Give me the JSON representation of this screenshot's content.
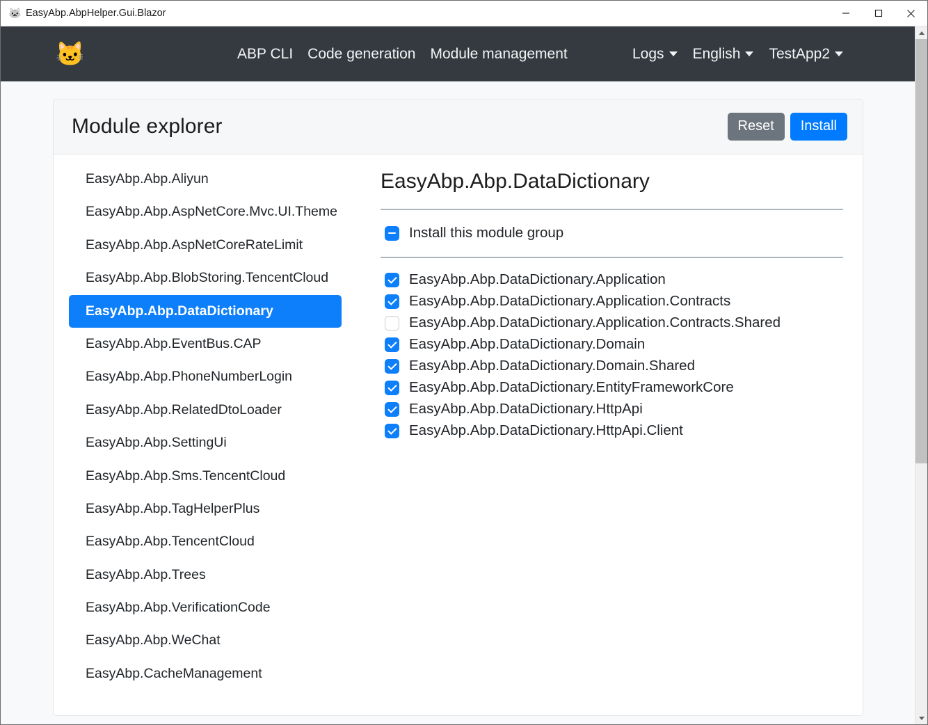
{
  "window": {
    "title": "EasyAbp.AbpHelper.Gui.Blazor",
    "app_icon": "cat-face-icon",
    "controls": {
      "minimize": "minimize-button",
      "maximize": "maximize-button",
      "close": "close-button"
    }
  },
  "navbar": {
    "brand_icon": "cat-face-logo",
    "links": [
      {
        "label": "ABP CLI"
      },
      {
        "label": "Code generation"
      },
      {
        "label": "Module management"
      }
    ],
    "dropdowns": [
      {
        "label": "Logs"
      },
      {
        "label": "English"
      },
      {
        "label": "TestApp2"
      }
    ]
  },
  "card": {
    "title": "Module explorer",
    "reset_label": "Reset",
    "install_label": "Install"
  },
  "module_list": {
    "items": [
      {
        "label": "EasyAbp.Abp.Aliyun",
        "active": false
      },
      {
        "label": "EasyAbp.Abp.AspNetCore.Mvc.UI.Theme",
        "active": false
      },
      {
        "label": "EasyAbp.Abp.AspNetCoreRateLimit",
        "active": false
      },
      {
        "label": "EasyAbp.Abp.BlobStoring.TencentCloud",
        "active": false
      },
      {
        "label": "EasyAbp.Abp.DataDictionary",
        "active": true
      },
      {
        "label": "EasyAbp.Abp.EventBus.CAP",
        "active": false
      },
      {
        "label": "EasyAbp.Abp.PhoneNumberLogin",
        "active": false
      },
      {
        "label": "EasyAbp.Abp.RelatedDtoLoader",
        "active": false
      },
      {
        "label": "EasyAbp.Abp.SettingUi",
        "active": false
      },
      {
        "label": "EasyAbp.Abp.Sms.TencentCloud",
        "active": false
      },
      {
        "label": "EasyAbp.Abp.TagHelperPlus",
        "active": false
      },
      {
        "label": "EasyAbp.Abp.TencentCloud",
        "active": false
      },
      {
        "label": "EasyAbp.Abp.Trees",
        "active": false
      },
      {
        "label": "EasyAbp.Abp.VerificationCode",
        "active": false
      },
      {
        "label": "EasyAbp.Abp.WeChat",
        "active": false
      },
      {
        "label": "EasyAbp.CacheManagement",
        "active": false
      }
    ]
  },
  "detail": {
    "title": "EasyAbp.Abp.DataDictionary",
    "group_checkbox": {
      "label": "Install this module group",
      "state": "indeterminate"
    },
    "modules": [
      {
        "label": "EasyAbp.Abp.DataDictionary.Application",
        "checked": true
      },
      {
        "label": "EasyAbp.Abp.DataDictionary.Application.Contracts",
        "checked": true
      },
      {
        "label": "EasyAbp.Abp.DataDictionary.Application.Contracts.Shared",
        "checked": false
      },
      {
        "label": "EasyAbp.Abp.DataDictionary.Domain",
        "checked": true
      },
      {
        "label": "EasyAbp.Abp.DataDictionary.Domain.Shared",
        "checked": true
      },
      {
        "label": "EasyAbp.Abp.DataDictionary.EntityFrameworkCore",
        "checked": true
      },
      {
        "label": "EasyAbp.Abp.DataDictionary.HttpApi",
        "checked": true
      },
      {
        "label": "EasyAbp.Abp.DataDictionary.HttpApi.Client",
        "checked": true
      }
    ]
  },
  "colors": {
    "navbar_bg": "#343a40",
    "accent_blue": "#0d7ffb",
    "primary_button": "#007bff",
    "secondary_button": "#6c757d",
    "page_bg": "#f8f9fa"
  }
}
